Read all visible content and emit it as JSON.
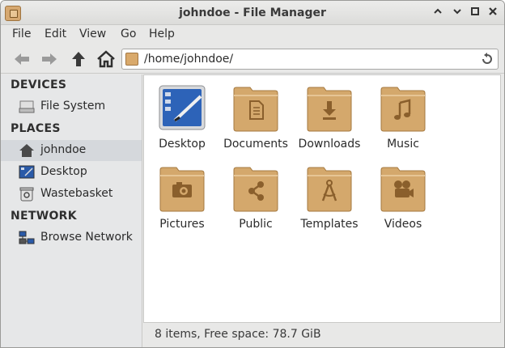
{
  "window": {
    "title": "johndoe - File Manager",
    "controls": [
      "up-arrow",
      "down-arrow",
      "maximize",
      "close"
    ]
  },
  "menubar": {
    "items": [
      "File",
      "Edit",
      "View",
      "Go",
      "Help"
    ]
  },
  "toolbar": {
    "location_path": "/home/johndoe/"
  },
  "sidebar": {
    "sections": [
      {
        "header": "DEVICES",
        "items": [
          {
            "label": "File System",
            "icon": "drive-icon"
          }
        ]
      },
      {
        "header": "PLACES",
        "items": [
          {
            "label": "johndoe",
            "icon": "home-icon",
            "selected": true
          },
          {
            "label": "Desktop",
            "icon": "desktop-icon"
          },
          {
            "label": "Wastebasket",
            "icon": "trash-icon"
          }
        ]
      },
      {
        "header": "NETWORK",
        "items": [
          {
            "label": "Browse Network",
            "icon": "network-icon"
          }
        ]
      }
    ]
  },
  "main": {
    "items": [
      {
        "label": "Desktop",
        "icon": "desktop-icon"
      },
      {
        "label": "Documents",
        "icon": "folder-documents-icon"
      },
      {
        "label": "Downloads",
        "icon": "folder-downloads-icon"
      },
      {
        "label": "Music",
        "icon": "folder-music-icon"
      },
      {
        "label": "Pictures",
        "icon": "folder-pictures-icon"
      },
      {
        "label": "Public",
        "icon": "folder-public-icon"
      },
      {
        "label": "Templates",
        "icon": "folder-templates-icon"
      },
      {
        "label": "Videos",
        "icon": "folder-videos-icon"
      }
    ]
  },
  "statusbar": {
    "text": "8 items, Free space: 78.7 GiB"
  },
  "colors": {
    "folder": "#d4a86c",
    "folder_dark": "#a4783f",
    "selected_row": "#d5d8dc",
    "sidebar_bg": "#e6e7e8"
  }
}
